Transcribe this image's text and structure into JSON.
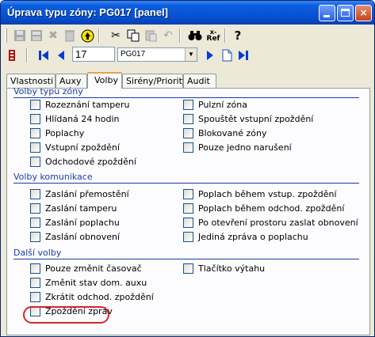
{
  "window": {
    "title": "Úprava typu zóny: PG017 [panel]",
    "minimize_label": "minimize",
    "maximize_label": "maximize",
    "close_label": "×"
  },
  "toolbar": {
    "binoculars_icon": "🔍",
    "ref_label": "Ref",
    "ref_prefix": "x-",
    "help_icon": "?"
  },
  "navigator": {
    "record_number": "17",
    "selected": "PG017"
  },
  "tabs": [
    {
      "label": "Vlastnosti"
    },
    {
      "label": "Auxy"
    },
    {
      "label": "Volby"
    },
    {
      "label": "Sirény/Priority"
    },
    {
      "label": "Audit"
    }
  ],
  "groups": {
    "zone_type": {
      "title": "Volby typu zóny",
      "left": [
        "Rozeznání tamperu",
        "Hlídaná 24 hodin",
        "Poplachy",
        "Vstupní zpoždění",
        "Odchodové zpoždění"
      ],
      "right": [
        "Pulzní zóna",
        "Spouštět vstupní zpoždění",
        "Blokované zóny",
        "Pouze jedno narušení"
      ]
    },
    "communication": {
      "title": "Volby komunikace",
      "left": [
        "Zaslání přemostění",
        "Zaslání tamperu",
        "Zaslání poplachu",
        "Zaslání obnovení"
      ],
      "right": [
        "Poplach během vstup. zpoždění",
        "Poplach během odchod. zpoždění",
        "Po otevření prostoru zaslat obnovení",
        "Jediná zpráva o poplachu"
      ]
    },
    "other": {
      "title": "Další volby",
      "left": [
        "Pouze změnit časovač",
        "Změnit stav dom. auxu",
        "Zkrátit odchod. zpoždění",
        "Zpoždění zpráv"
      ],
      "right": [
        "Tlačítko výtahu"
      ]
    }
  }
}
